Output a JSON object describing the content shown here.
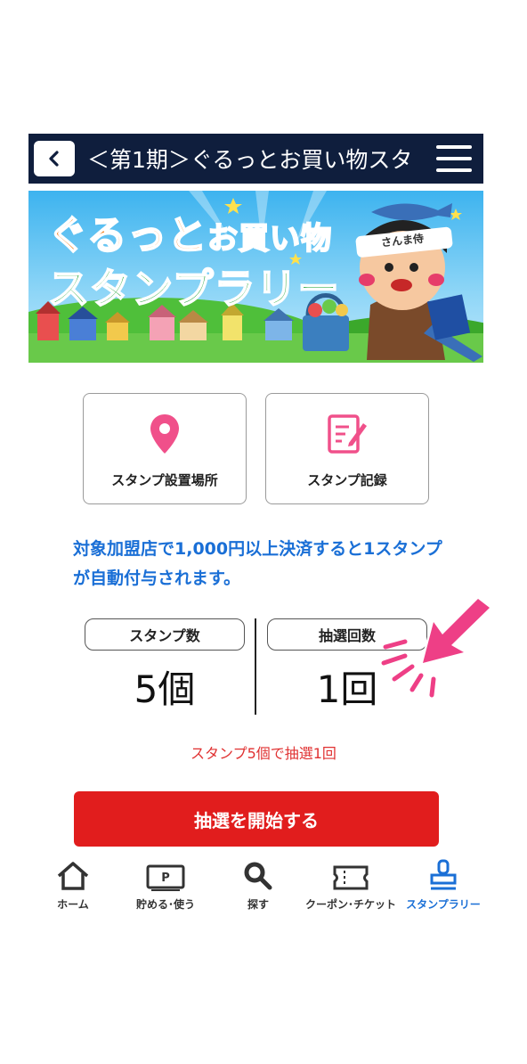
{
  "header": {
    "back_icon": "chevron-left-icon",
    "title": "＜第1期＞ぐるっとお買い物スタ",
    "menu_icon": "hamburger-icon"
  },
  "banner": {
    "line1_a": "ぐるっと",
    "line1_b": "お買い物",
    "line2": "スタンプラリー",
    "character_label": "さんま侍"
  },
  "menu": [
    {
      "label": "スタンプ設置場所",
      "icon": "map-pin-icon"
    },
    {
      "label": "スタンプ記録",
      "icon": "notepad-pen-icon"
    }
  ],
  "notice": "対象加盟店で1,000円以上決済すると1スタンプが自動付与されます。",
  "stats": {
    "stamps_label": "スタンプ数",
    "stamps_value": "5個",
    "draws_label": "抽選回数",
    "draws_value": "1回"
  },
  "rule": "スタンプ5個で抽選1回",
  "start_button": "抽選を開始する",
  "tabs": [
    {
      "label": "ホーム",
      "icon": "home-icon",
      "active": false
    },
    {
      "label": "貯める･使う",
      "icon": "point-card-icon",
      "active": false
    },
    {
      "label": "探す",
      "icon": "search-icon",
      "active": false
    },
    {
      "label": "クーポン･チケット",
      "icon": "ticket-icon",
      "active": false
    },
    {
      "label": "スタンプラリー",
      "icon": "stamp-icon",
      "active": true
    }
  ],
  "colors": {
    "header_bg": "#0f1e3d",
    "accent_blue": "#1a6fd6",
    "button_red": "#e11d1d",
    "rule_red": "#e03131",
    "pin_pink": "#f0508a",
    "arrow_pink": "#ee3f86"
  }
}
